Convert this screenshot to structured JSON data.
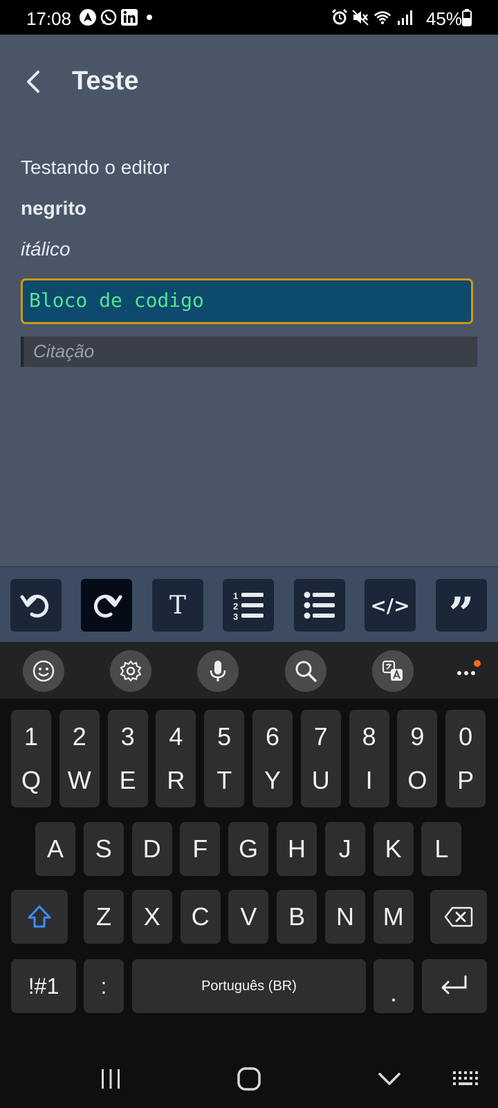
{
  "status_bar": {
    "time": "17:08",
    "battery": "45%",
    "left_icons": [
      "location-icon",
      "whatsapp-icon",
      "linkedin-icon",
      "dot-icon"
    ],
    "right_icons": [
      "alarm-icon",
      "mute-icon",
      "wifi-icon",
      "signal-icon",
      "battery-icon"
    ]
  },
  "header": {
    "title": "Teste"
  },
  "editor": {
    "line1": "Testando o editor",
    "bold_line": "negrito",
    "italic_line": "itálico",
    "code_block": "Bloco de codigo",
    "quote_placeholder": "Citação"
  },
  "toolbar": {
    "buttons": [
      "undo-icon",
      "redo-icon",
      "text-format-icon",
      "numbered-list-icon",
      "bullet-list-icon",
      "code-icon",
      "quote-icon"
    ],
    "active": "redo-icon",
    "text_glyph": "T",
    "code_glyph": "</>",
    "quote_glyph": "”"
  },
  "keyboard": {
    "toolbar_icons": [
      "emoji-icon",
      "settings-icon",
      "mic-icon",
      "search-icon",
      "translate-icon",
      "more-icon"
    ],
    "row_numbers": [
      "1",
      "2",
      "3",
      "4",
      "5",
      "6",
      "7",
      "8",
      "9",
      "0"
    ],
    "row1": [
      "Q",
      "W",
      "E",
      "R",
      "T",
      "Y",
      "U",
      "I",
      "O",
      "P"
    ],
    "row2": [
      "A",
      "S",
      "D",
      "F",
      "G",
      "H",
      "J",
      "K",
      "L"
    ],
    "row3": [
      "Z",
      "X",
      "C",
      "V",
      "B",
      "N",
      "M"
    ],
    "symbols_key": "!#1",
    "colon_key": ":",
    "space_label": "Português (BR)",
    "period_key": ".",
    "accent_color": "#3d8ef7",
    "notification_dot_color": "#f26a1b"
  },
  "navbar": {
    "icons": [
      "recent-apps-icon",
      "home-icon",
      "hide-keyboard-icon",
      "keyboard-switch-icon"
    ]
  }
}
